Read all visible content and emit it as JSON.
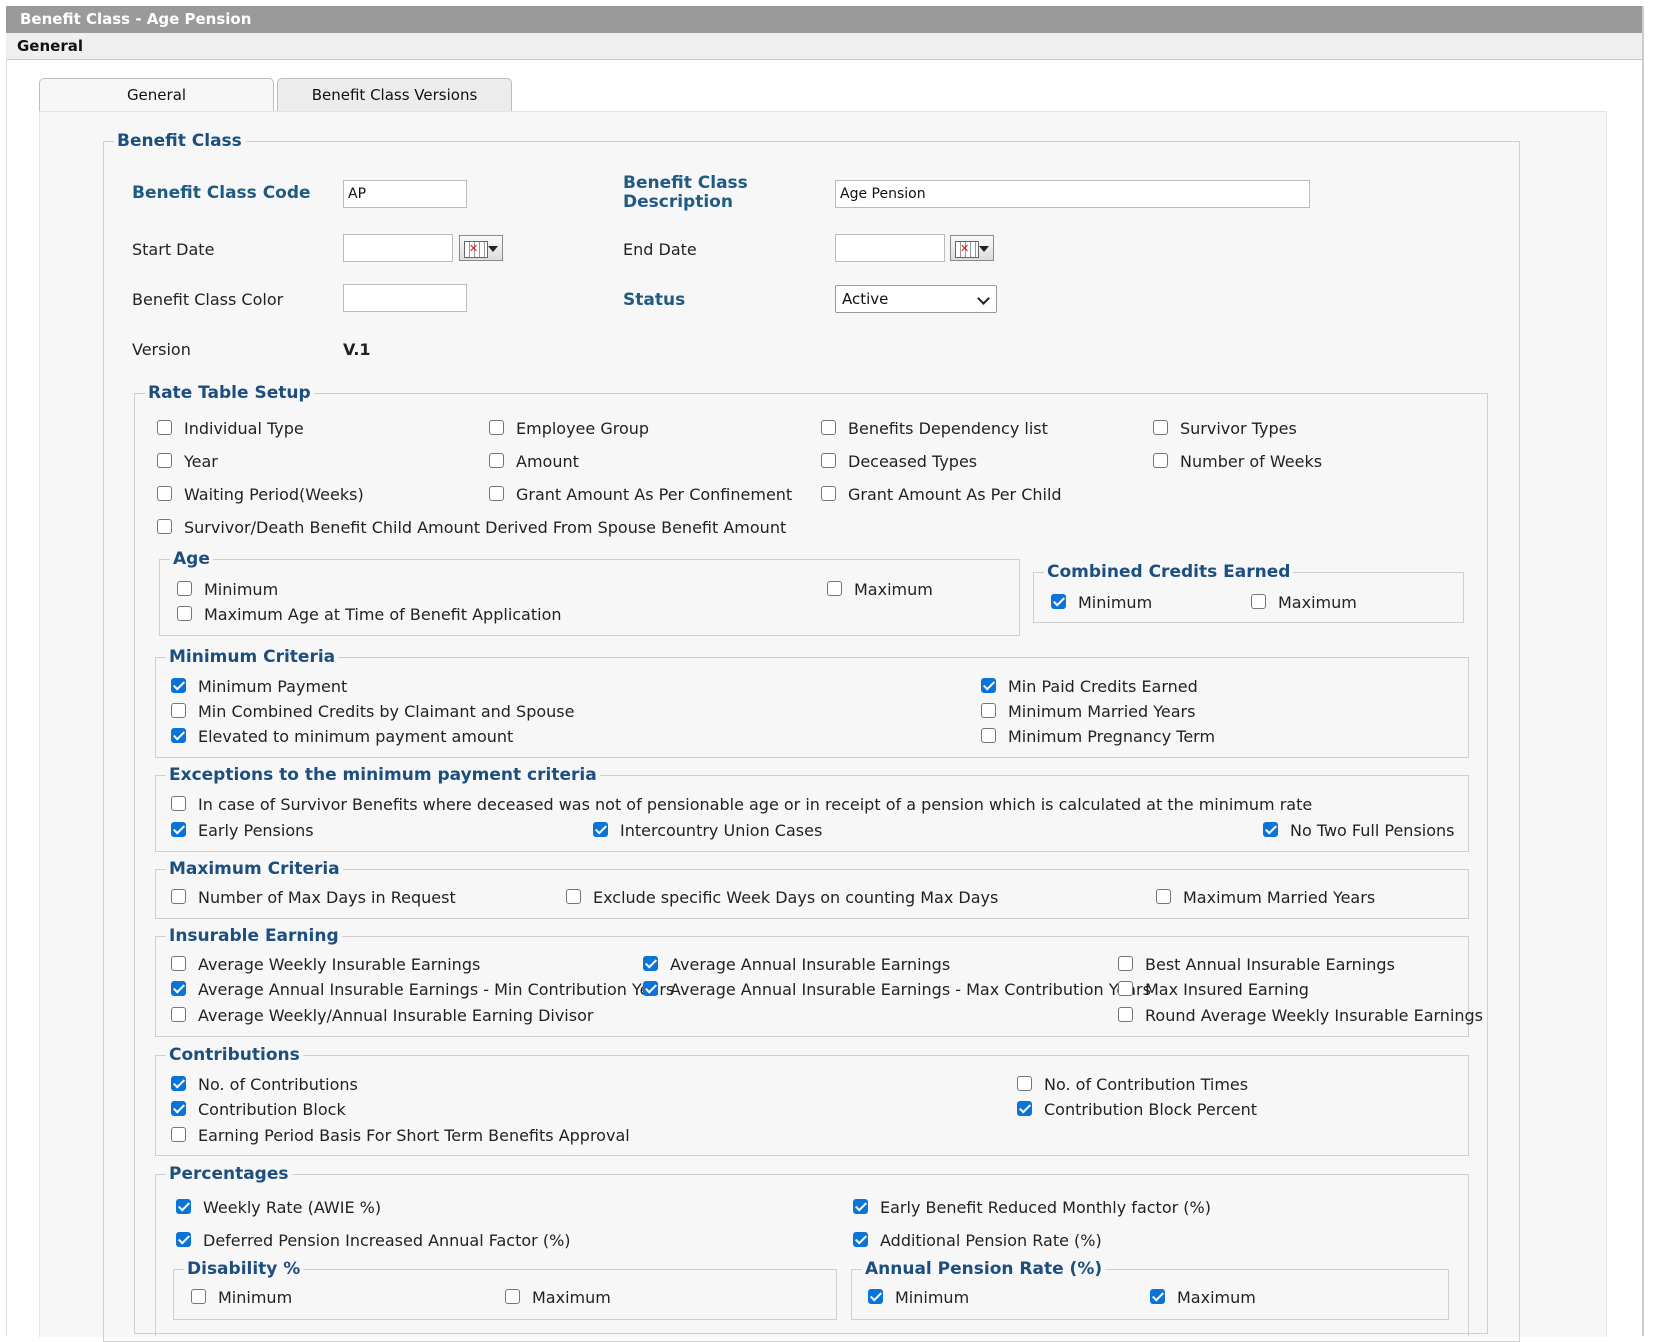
{
  "window": {
    "title": "Benefit Class - Age Pension",
    "subtitle": "General"
  },
  "tabs": [
    {
      "label": "General",
      "active": true
    },
    {
      "label": "Benefit Class Versions",
      "active": false
    }
  ],
  "benefit_class": {
    "legend": "Benefit Class",
    "code": {
      "label": "Benefit Class Code",
      "value": "AP"
    },
    "description": {
      "label_line1": "Benefit Class",
      "label_line2": "Description",
      "value": "Age Pension"
    },
    "start_date": {
      "label": "Start Date",
      "value": ""
    },
    "end_date": {
      "label": "End Date",
      "value": ""
    },
    "color": {
      "label": "Benefit Class Color",
      "value": ""
    },
    "status": {
      "label": "Status",
      "value": "Active"
    },
    "version": {
      "label": "Version",
      "value": "V.1"
    }
  },
  "rate_table": {
    "legend": "Rate Table Setup",
    "items": [
      {
        "label": "Individual Type",
        "checked": false
      },
      {
        "label": "Employee Group",
        "checked": false
      },
      {
        "label": "Benefits Dependency list",
        "checked": false
      },
      {
        "label": "Survivor Types",
        "checked": false
      },
      {
        "label": "Year",
        "checked": false
      },
      {
        "label": "Amount",
        "checked": false
      },
      {
        "label": "Deceased Types",
        "checked": false
      },
      {
        "label": "Number of Weeks",
        "checked": false
      },
      {
        "label": "Waiting Period(Weeks)",
        "checked": false
      },
      {
        "label": "Grant Amount As Per Confinement",
        "checked": false
      },
      {
        "label": "Grant Amount As Per Child",
        "checked": false
      },
      {
        "label": "Survivor/Death Benefit Child Amount Derived From Spouse Benefit Amount",
        "checked": false
      }
    ]
  },
  "age": {
    "legend": "Age",
    "items": [
      {
        "label": "Minimum",
        "checked": false
      },
      {
        "label": "Maximum",
        "checked": false
      },
      {
        "label": "Maximum Age at Time of Benefit Application",
        "checked": false
      }
    ]
  },
  "combined_credits": {
    "legend": "Combined Credits Earned",
    "items": [
      {
        "label": "Minimum",
        "checked": true
      },
      {
        "label": "Maximum",
        "checked": false
      }
    ]
  },
  "minimum_criteria": {
    "legend": "Minimum Criteria",
    "items": [
      {
        "label": "Minimum Payment",
        "checked": true
      },
      {
        "label": "Min Paid Credits Earned",
        "checked": true
      },
      {
        "label": "Min Combined Credits by Claimant and Spouse",
        "checked": false
      },
      {
        "label": "Minimum Married Years",
        "checked": false
      },
      {
        "label": "Elevated to minimum payment amount",
        "checked": true
      },
      {
        "label": "Minimum Pregnancy Term",
        "checked": false
      }
    ]
  },
  "exceptions": {
    "legend": "Exceptions to the minimum payment criteria",
    "items": [
      {
        "label": "In case of Survivor Benefits where deceased was not of pensionable age or in receipt of a pension which is calculated at the minimum rate",
        "checked": false
      },
      {
        "label": "Early Pensions",
        "checked": true
      },
      {
        "label": "Intercountry Union Cases",
        "checked": true
      },
      {
        "label": "No Two Full Pensions",
        "checked": true
      }
    ]
  },
  "maximum_criteria": {
    "legend": "Maximum Criteria",
    "items": [
      {
        "label": "Number of Max Days in Request",
        "checked": false
      },
      {
        "label": "Exclude specific Week Days on counting Max Days",
        "checked": false
      },
      {
        "label": "Maximum Married Years",
        "checked": false
      }
    ]
  },
  "insurable_earning": {
    "legend": "Insurable Earning",
    "items": [
      {
        "label": "Average Weekly Insurable Earnings",
        "checked": false
      },
      {
        "label": "Average Annual Insurable Earnings",
        "checked": true
      },
      {
        "label": "Best Annual Insurable Earnings",
        "checked": false
      },
      {
        "label": "Average Annual Insurable Earnings - Min Contribution Years",
        "checked": true
      },
      {
        "label": "Average Annual Insurable Earnings - Max Contribution Years",
        "checked": true
      },
      {
        "label": "Max Insured Earning",
        "checked": false
      },
      {
        "label": "Average Weekly/Annual Insurable Earning Divisor",
        "checked": false
      },
      {
        "label": "Round Average Weekly Insurable Earnings",
        "checked": false
      }
    ]
  },
  "contributions": {
    "legend": "Contributions",
    "items": [
      {
        "label": "No. of Contributions",
        "checked": true
      },
      {
        "label": "No. of Contribution Times",
        "checked": false
      },
      {
        "label": "Contribution Block",
        "checked": true
      },
      {
        "label": "Contribution Block Percent",
        "checked": true
      },
      {
        "label": "Earning Period Basis For Short Term Benefits Approval",
        "checked": false
      }
    ]
  },
  "percentages": {
    "legend": "Percentages",
    "items": [
      {
        "label": "Weekly Rate (AWIE %)",
        "checked": true
      },
      {
        "label": "Early Benefit Reduced Monthly factor (%)",
        "checked": true
      },
      {
        "label": "Deferred Pension Increased Annual Factor (%)",
        "checked": true
      },
      {
        "label": "Additional Pension Rate (%)",
        "checked": true
      }
    ],
    "disability": {
      "legend": "Disability %",
      "items": [
        {
          "label": "Minimum",
          "checked": false
        },
        {
          "label": "Maximum",
          "checked": false
        }
      ]
    },
    "annual_pension_rate": {
      "legend": "Annual Pension Rate (%)",
      "items": [
        {
          "label": "Minimum",
          "checked": true
        },
        {
          "label": "Maximum",
          "checked": true
        }
      ]
    }
  }
}
